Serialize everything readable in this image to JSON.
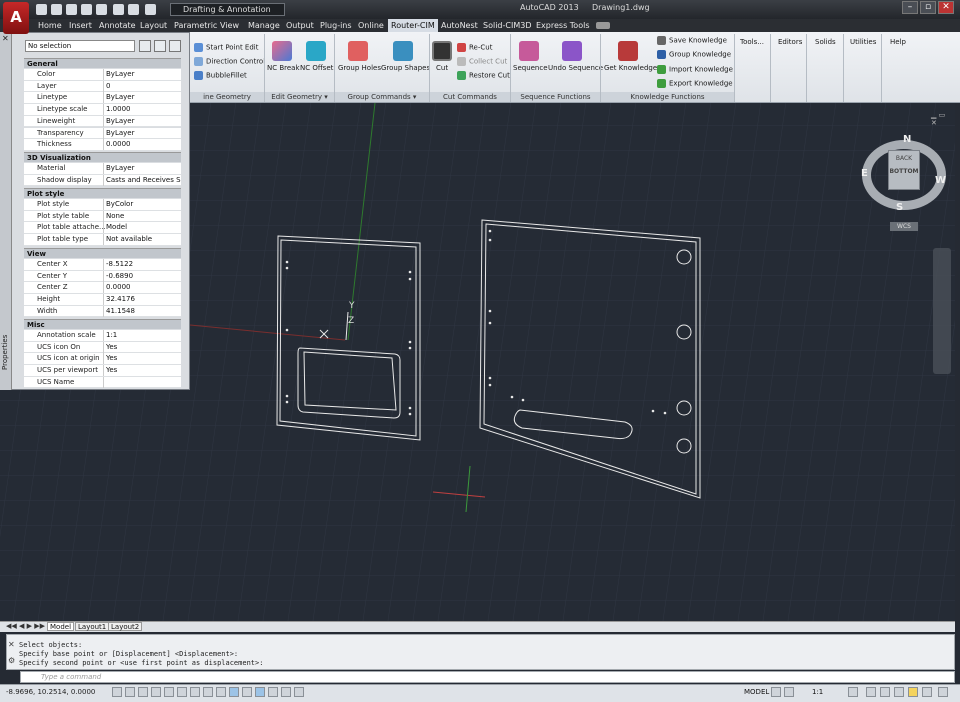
{
  "app": {
    "logo": "A",
    "title": "AutoCAD 2013",
    "document": "Drawing1.dwg",
    "workspace": "Drafting & Annotation"
  },
  "window_controls": [
    "–",
    "▫",
    "✕"
  ],
  "tabs": [
    "Home",
    "Insert",
    "Annotate",
    "Layout",
    "Parametric",
    "View",
    "Manage",
    "Output",
    "Plug-ins",
    "Online",
    "Router-CIM",
    "AutoNest",
    "Solid-CIM3D",
    "Express Tools"
  ],
  "active_tab": "Router-CIM",
  "ribbon": {
    "small_group1": [
      "Start Point Edit",
      "Direction Control",
      "BubbleFillet"
    ],
    "edit_geometry": [
      "NC Break",
      "NC Offset"
    ],
    "group_commands": [
      "Group Holes",
      "Group Shapes"
    ],
    "cut_large": "Cut",
    "cut_small": [
      "Re-Cut",
      "Collect Cut",
      "Restore Cut"
    ],
    "sequence": [
      "Sequence",
      "Undo Sequence"
    ],
    "get_knowledge": "Get Knowledge",
    "knowledge_small": [
      "Save Knowledge",
      "Group Knowledge",
      "Import Knowledge",
      "Export Knowledge"
    ],
    "right_panels": [
      "Tools...",
      "Editors",
      "Solids",
      "Utilities",
      "Help"
    ],
    "panel_titles": [
      "ine Geometry",
      "Edit Geometry ▾",
      "Group Commands ▾",
      "Cut Commands",
      "Sequence Functions",
      "Knowledge Functions"
    ]
  },
  "properties": {
    "side_label": "Properties",
    "selection": "No selection",
    "groups": [
      {
        "title": "General",
        "rows": [
          [
            "Color",
            "ByLayer"
          ],
          [
            "Layer",
            "0"
          ],
          [
            "Linetype",
            "ByLayer"
          ],
          [
            "Linetype scale",
            "1.0000"
          ],
          [
            "Lineweight",
            "ByLayer"
          ],
          [
            "Transparency",
            "ByLayer"
          ],
          [
            "Thickness",
            "0.0000"
          ]
        ]
      },
      {
        "title": "3D Visualization",
        "rows": [
          [
            "Material",
            "ByLayer"
          ],
          [
            "Shadow display",
            "Casts and Receives Sh..."
          ]
        ]
      },
      {
        "title": "Plot style",
        "rows": [
          [
            "Plot style",
            "ByColor"
          ],
          [
            "Plot style table",
            "None"
          ],
          [
            "Plot table attache...",
            "Model"
          ],
          [
            "Plot table type",
            "Not available"
          ]
        ]
      },
      {
        "title": "View",
        "rows": [
          [
            "Center X",
            "-8.5122"
          ],
          [
            "Center Y",
            "-0.6890"
          ],
          [
            "Center Z",
            "0.0000"
          ],
          [
            "Height",
            "32.4176"
          ],
          [
            "Width",
            "41.1548"
          ]
        ]
      },
      {
        "title": "Misc",
        "rows": [
          [
            "Annotation scale",
            "1:1"
          ],
          [
            "UCS icon On",
            "Yes"
          ],
          [
            "UCS icon at origin",
            "Yes"
          ],
          [
            "UCS per viewport",
            "Yes"
          ],
          [
            "UCS Name",
            ""
          ]
        ]
      }
    ]
  },
  "viewcube": {
    "north": "N",
    "south": "S",
    "east": "E",
    "west": "W",
    "top_face": "BOTTOM",
    "back_face": "BACK",
    "wcs": "WCS"
  },
  "ucs_labels": {
    "x": "X",
    "y": "Y",
    "z": "Z"
  },
  "layout_tabs": [
    "Model",
    "Layout1",
    "Layout2"
  ],
  "command_history": [
    "Select objects:",
    "Specify base point or [Displacement] <Displacement>:",
    "Specify second point or <use first point as displacement>:"
  ],
  "command_placeholder": "Type a command",
  "status": {
    "coords": "-8.9696, 10.2514, 0.0000",
    "model": "MODEL",
    "scale": "1:1"
  }
}
